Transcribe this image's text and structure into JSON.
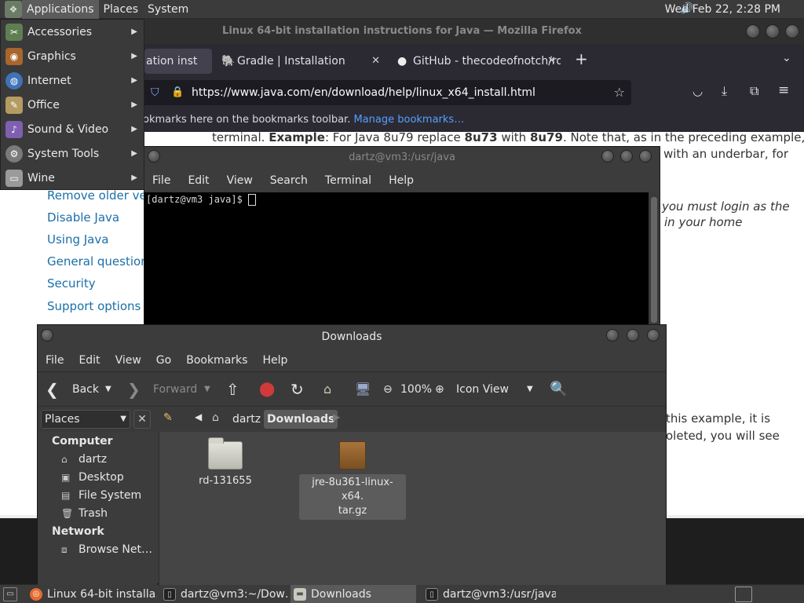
{
  "top_panel": {
    "menus": [
      "Applications",
      "Places",
      "System"
    ],
    "clock": "Wed Feb 22,  2:28 PM"
  },
  "apps_menu": {
    "items": [
      {
        "label": "Accessories",
        "icon": "accessories-icon",
        "color": "#7aa06a"
      },
      {
        "label": "Graphics",
        "icon": "graphics-icon",
        "color": "#c07a3c"
      },
      {
        "label": "Internet",
        "icon": "internet-icon",
        "color": "#5a8fd0"
      },
      {
        "label": "Office",
        "icon": "office-icon",
        "color": "#c9b27a"
      },
      {
        "label": "Sound & Video",
        "icon": "sound-video-icon",
        "color": "#a57ad0"
      },
      {
        "label": "System Tools",
        "icon": "system-tools-icon",
        "color": "#9a9a9a"
      },
      {
        "label": "Wine",
        "icon": "wine-icon",
        "color": "#b0b0b0"
      }
    ]
  },
  "firefox": {
    "title": "Linux 64-bit installation instructions for Java — Mozilla Firefox",
    "tabs": [
      {
        "label": "ation inst"
      },
      {
        "label": "Gradle | Installation"
      },
      {
        "label": "GitHub - thecodeofnotch/rd"
      }
    ],
    "url": "https://www.java.com/en/download/help/linux_x64_install.html",
    "bookmarks_text": "okmarks here on the bookmarks toolbar.",
    "bookmarks_link": "Manage bookmarks…",
    "side_links": [
      "Remove older vers",
      "Disable Java",
      "Using Java",
      "General questions",
      "Security",
      "Support options"
    ],
    "article": {
      "line1_a": "terminal.",
      "line1_b": "Example",
      "line1_c": ": For Java 8u79 replace",
      "line1_d": "8u73",
      "line1_e": "with",
      "line1_f": "8u79",
      "line1_g": ". Note that, as in the preceding example, the",
      "line2": "with an underbar, for",
      "line3": "you must login as the",
      "line4": "in your home",
      "line5": "this example, it is",
      "line6": "oleted, you will see"
    }
  },
  "terminal": {
    "title": "dartz@vm3:/usr/java",
    "menu": [
      "File",
      "Edit",
      "View",
      "Search",
      "Terminal",
      "Help"
    ],
    "prompt": "[dartz@vm3 java]$ "
  },
  "file_manager": {
    "title": "Downloads",
    "menu": [
      "File",
      "Edit",
      "View",
      "Go",
      "Bookmarks",
      "Help"
    ],
    "toolbar": {
      "back": "Back",
      "forward": "Forward",
      "zoom": "100%",
      "view_mode": "Icon View"
    },
    "places_label": "Places",
    "breadcrumbs": [
      "dartz",
      "Downloads"
    ],
    "sidebar": {
      "computer_header": "Computer",
      "computer_items": [
        "dartz",
        "Desktop",
        "File System",
        "Trash"
      ],
      "network_header": "Network",
      "network_items": [
        "Browse Net…"
      ]
    },
    "files": [
      {
        "name": "rd-131655",
        "type": "folder"
      },
      {
        "name_line1": "jre-8u361-linux-x64.",
        "name_line2": "tar.gz",
        "type": "package"
      }
    ]
  },
  "taskbar": {
    "tasks": [
      "Linux 64-bit installa…",
      "dartz@vm3:~/Dow…",
      "Downloads",
      "dartz@vm3:/usr/java"
    ]
  }
}
